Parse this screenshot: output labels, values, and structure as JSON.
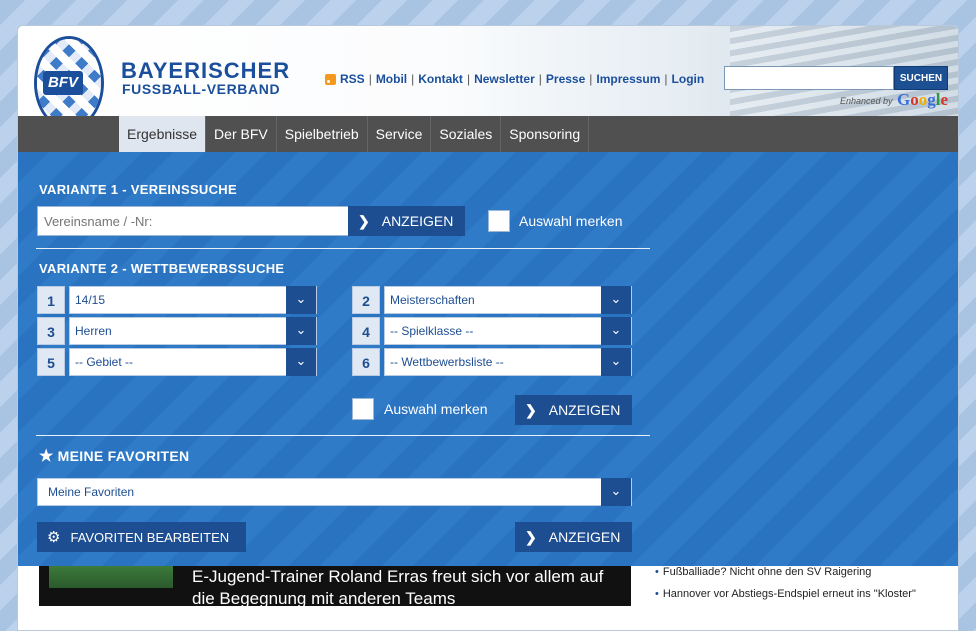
{
  "header": {
    "brand_line1": "BAYERISCHER",
    "brand_line2": "FUSSBALL-VERBAND",
    "logo_text": "BFV",
    "links": [
      "RSS",
      "Mobil",
      "Kontakt",
      "Newsletter",
      "Presse",
      "Impressum",
      "Login"
    ],
    "search_button": "SUCHEN",
    "enhanced_by": "Enhanced by",
    "google": "Google"
  },
  "nav": {
    "items": [
      "Ergebnisse",
      "Der BFV",
      "Spielbetrieb",
      "Service",
      "Soziales",
      "Sponsoring"
    ],
    "active": "Ergebnisse"
  },
  "variant1": {
    "heading": "VARIANTE 1 - VEREINSSUCHE",
    "placeholder": "Vereinsname / -Nr:",
    "button": "ANZEIGEN",
    "remember": "Auswahl merken"
  },
  "variant2": {
    "heading": "VARIANTE 2 - WETTBEWERBSSUCHE",
    "selects": [
      {
        "num": "1",
        "value": "14/15"
      },
      {
        "num": "2",
        "value": "Meisterschaften"
      },
      {
        "num": "3",
        "value": "Herren"
      },
      {
        "num": "4",
        "value": "-- Spielklasse --"
      },
      {
        "num": "5",
        "value": "-- Gebiet --"
      },
      {
        "num": "6",
        "value": "-- Wettbewerbsliste --"
      }
    ],
    "remember": "Auswahl merken",
    "button": "ANZEIGEN"
  },
  "favorites": {
    "heading": "MEINE FAVORITEN",
    "select_value": "Meine Favoriten",
    "edit_button": "FAVORITEN BEARBEITEN",
    "button": "ANZEIGEN"
  },
  "news": {
    "headline": "E-Jugend-Trainer Roland Erras freut sich vor allem auf die Begegnung mit anderen Teams",
    "items": [
      "Fußballiade? Nicht ohne den SV Raigering",
      "Hannover vor Abstiegs-Endspiel erneut ins \"Kloster\""
    ]
  },
  "colors": {
    "brand_blue": "#1b4f9c",
    "panel_blue": "#2a73c0",
    "nav_gray": "#505050"
  }
}
